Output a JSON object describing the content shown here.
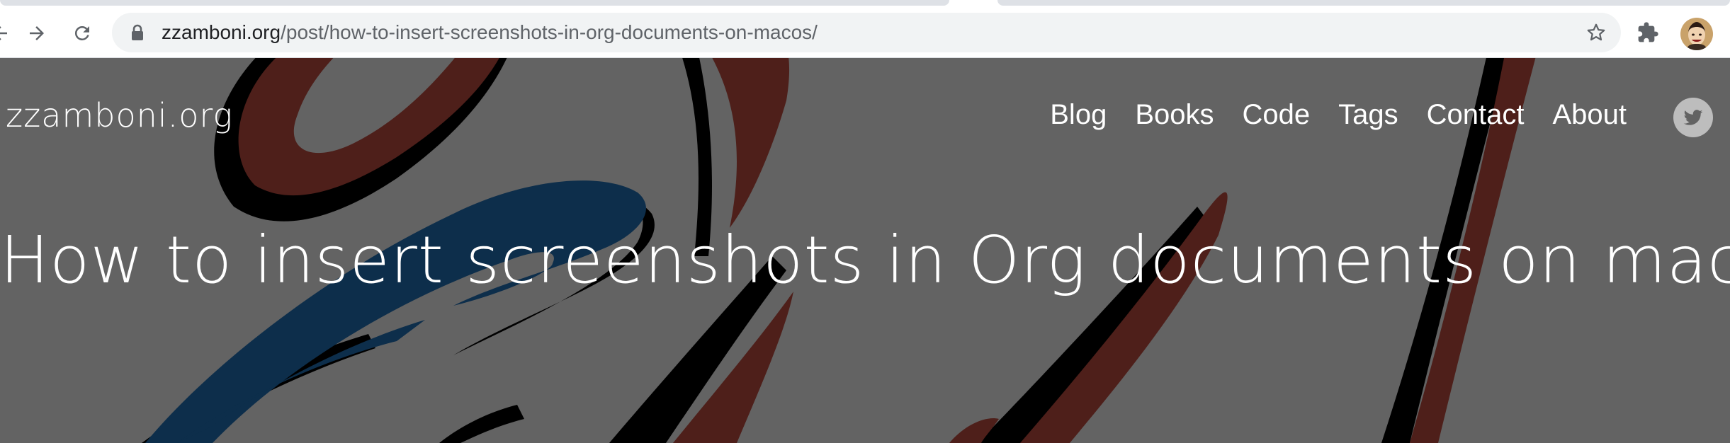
{
  "browser": {
    "url_host": "zzamboni.org",
    "url_path": "/post/how-to-insert-screenshots-in-org-documents-on-macos/",
    "icons": {
      "back": "back-arrow-icon",
      "forward": "forward-arrow-icon",
      "reload": "reload-icon",
      "lock": "lock-icon",
      "bookmark": "star-icon",
      "extensions": "puzzle-piece-icon",
      "profile": "avatar"
    }
  },
  "site": {
    "logo": "zzamboni.org",
    "nav": [
      "Blog",
      "Books",
      "Code",
      "Tags",
      "Contact",
      "About"
    ],
    "social_icon": "twitter-icon"
  },
  "post": {
    "title": "How to insert screenshots in Org documents on macOS"
  },
  "colors": {
    "hero_background": "#636363",
    "art_red": "#4e1f1a",
    "art_blue": "#0d2e4b",
    "art_black": "#000000",
    "omnibox": "#f1f3f4"
  }
}
